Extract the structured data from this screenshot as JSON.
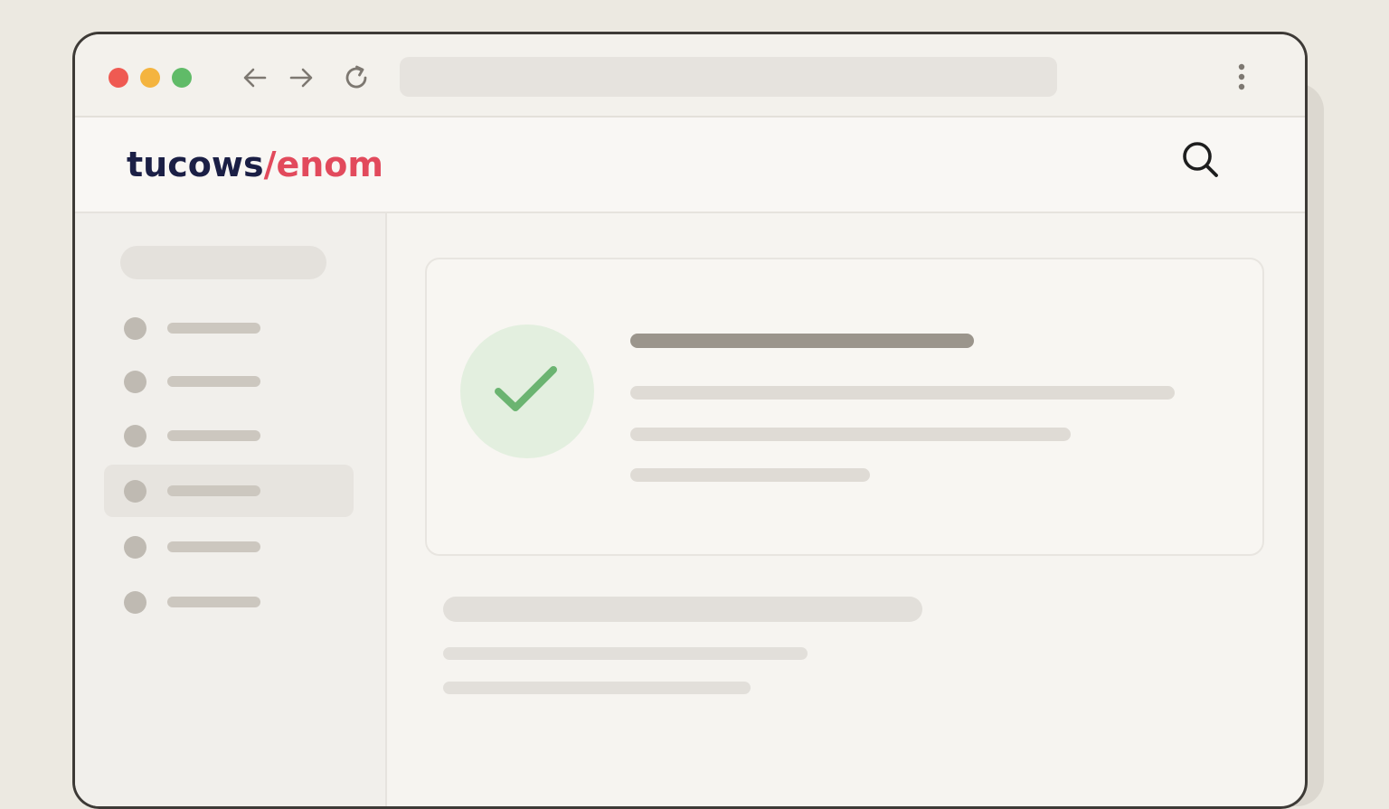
{
  "colors": {
    "accent_red": "#e24a5c",
    "brand_navy": "#1b1f45",
    "success_green": "#6bb471",
    "traffic_close": "#ef5a52",
    "traffic_minimize": "#f4b43f",
    "traffic_maximize": "#60bb68"
  },
  "browser": {
    "traffic_lights": [
      "close",
      "minimize",
      "maximize"
    ],
    "nav_icons": [
      "arrow-left-icon",
      "arrow-right-icon",
      "reload-icon"
    ],
    "url": "",
    "menu_icon": "kebab-menu-icon"
  },
  "site": {
    "logo": {
      "part1": "tucows",
      "part2": "/enom"
    },
    "search_icon": "search-icon"
  },
  "sidebar": {
    "search_placeholder": "",
    "items": [
      {
        "label": "",
        "active": false
      },
      {
        "label": "",
        "active": false
      },
      {
        "label": "",
        "active": false
      },
      {
        "label": "",
        "active": true
      },
      {
        "label": "",
        "active": false
      },
      {
        "label": "",
        "active": false
      }
    ]
  },
  "main": {
    "card": {
      "status_icon": "check-icon",
      "title": "",
      "lines": [
        "",
        "",
        ""
      ]
    },
    "section": {
      "heading": "",
      "lines": [
        "",
        ""
      ]
    }
  }
}
